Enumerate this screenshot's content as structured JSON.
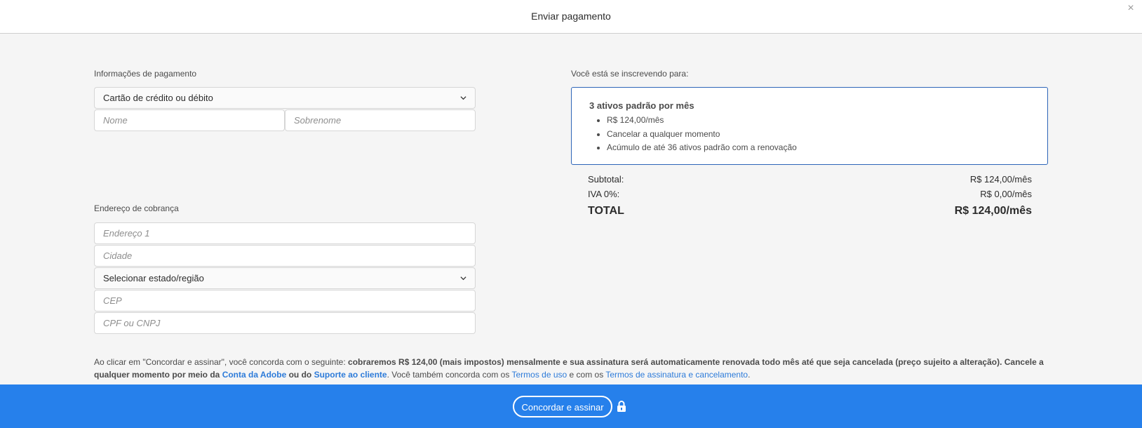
{
  "header": {
    "title": "Enviar pagamento",
    "close_label": "×"
  },
  "payment": {
    "section_label": "Informações de pagamento",
    "method_value": "Cartão de crédito ou débito",
    "first_name_placeholder": "Nome",
    "last_name_placeholder": "Sobrenome"
  },
  "billing": {
    "section_label": "Endereço de cobrança",
    "address1_placeholder": "Endereço 1",
    "city_placeholder": "Cidade",
    "state_value": "Selecionar estado/região",
    "zip_placeholder": "CEP",
    "tax_id_placeholder": "CPF ou CNPJ"
  },
  "subscription": {
    "section_label": "Você está se inscrevendo para:",
    "plan_title": "3 ativos padrão por mês",
    "features": [
      "R$ 124,00/mês",
      "Cancelar a qualquer momento",
      "Acúmulo de até 36 ativos padrão com a renovação"
    ]
  },
  "totals": {
    "subtotal_label": "Subtotal:",
    "subtotal_value": "R$ 124,00/mês",
    "tax_label": "IVA 0%:",
    "tax_value": "R$ 0,00/mês",
    "total_label": "TOTAL",
    "total_value": "R$ 124,00/mês"
  },
  "legal": {
    "intro": "Ao clicar em \"Concordar e assinar\", você concorda com o seguinte: ",
    "bold_terms": "cobraremos R$ 124,00 (mais impostos) mensalmente e sua assinatura será automaticamente renovada todo mês até que seja cancelada (preço sujeito a alteração). Cancele a qualquer momento por meio da ",
    "account_link": "Conta da Adobe",
    "or_text": " ou do ",
    "support_link": "Suporte ao cliente",
    "also_text": ". Você também concorda com os ",
    "terms_link": "Termos de uso",
    "and_text": " e com os ",
    "cancel_terms_link": "Termos de assinatura e cancelamento",
    "end_text": "."
  },
  "footer": {
    "agree_button": "Concordar e assinar"
  },
  "colors": {
    "accent": "#2680eb",
    "link": "#2d7bd9",
    "box_border": "#2d65b8"
  },
  "icons": {
    "close": "close-icon",
    "chevron": "chevron-down-icon",
    "lock": "lock-icon"
  }
}
